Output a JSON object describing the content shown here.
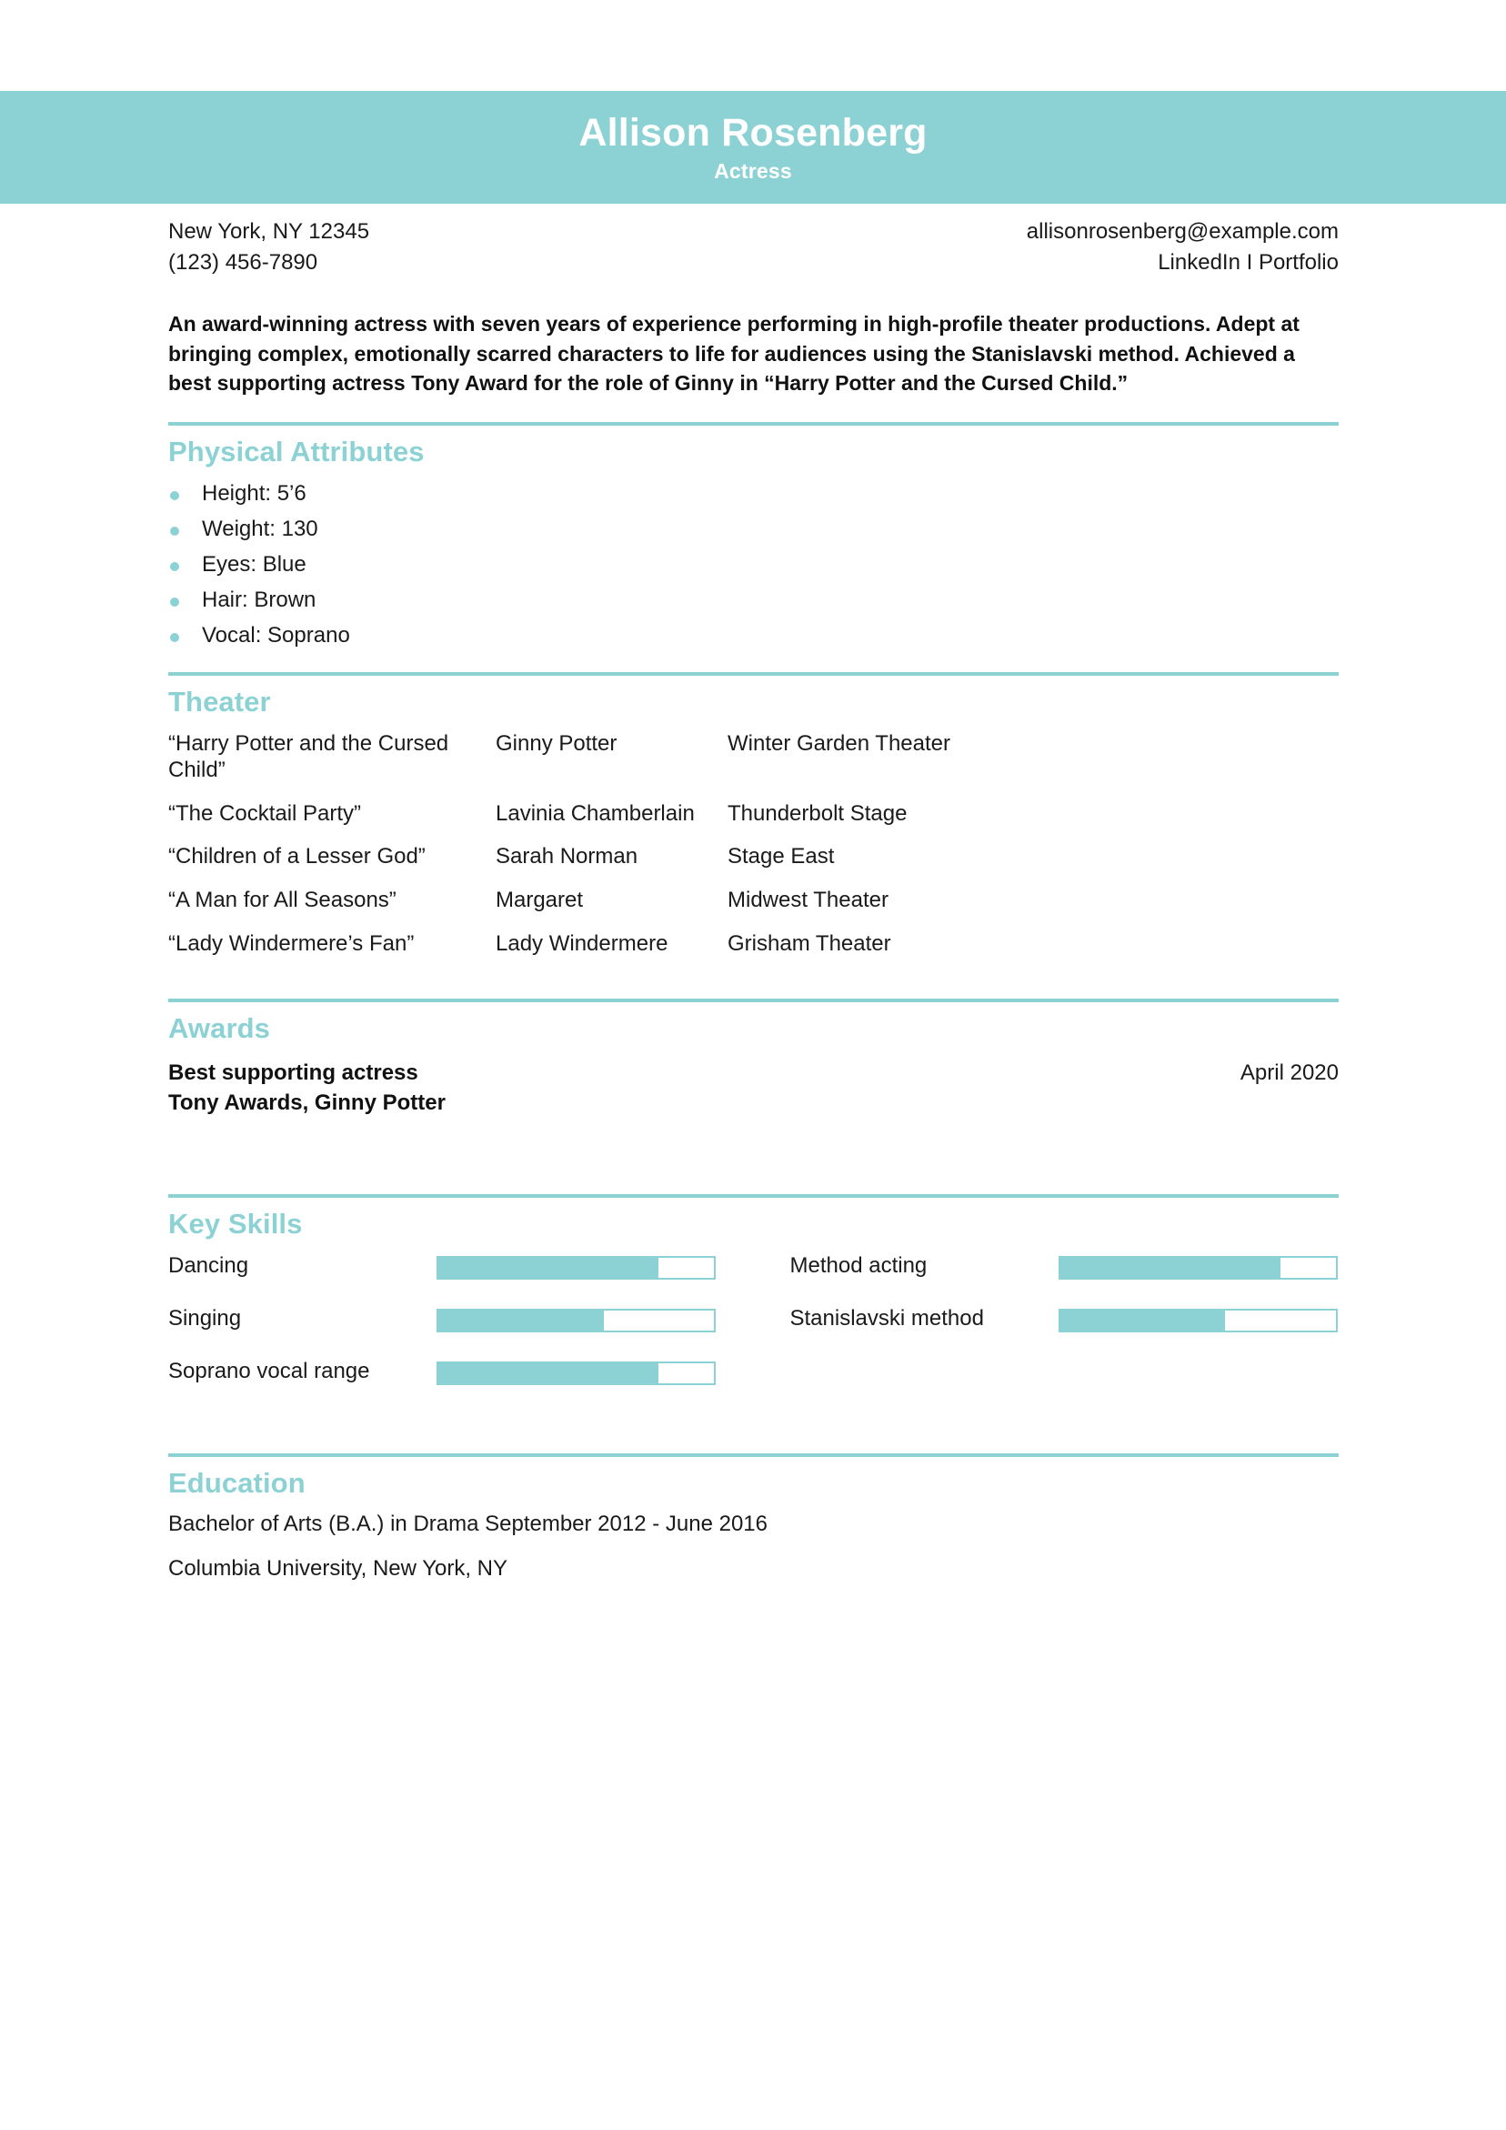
{
  "colors": {
    "accent": "#8CD2D4",
    "header_text": "#ffffff",
    "body_text": "#1a1a1a"
  },
  "header": {
    "name": "Allison Rosenberg",
    "role": "Actress"
  },
  "contact": {
    "location": "New York, NY 12345",
    "phone": "(123) 456-7890",
    "email": "allisonrosenberg@example.com",
    "links": "LinkedIn I Portfolio"
  },
  "summary": {
    "text": "An award-winning actress with seven years of experience performing in high-profile theater productions. Adept at bringing complex, emotionally scarred characters to life for audiences using the Stanislavski method. Achieved a best supporting actress Tony Award for the role of Ginny in “Harry Potter and the Cursed Child.”"
  },
  "physical_attributes": {
    "title": "Physical Attributes",
    "items": [
      "Height: 5’6",
      "Weight: 130",
      "Eyes: Blue",
      "Hair: Brown",
      "Vocal: Soprano"
    ]
  },
  "theater": {
    "title": "Theater",
    "rows": [
      {
        "show": "“Harry Potter and the Cursed Child”",
        "role": "Ginny Potter",
        "venue": "Winter Garden Theater"
      },
      {
        "show": "“The Cocktail Party”",
        "role": "Lavinia Chamberlain",
        "venue": "Thunderbolt Stage"
      },
      {
        "show": "“Children of a Lesser God”",
        "role": "Sarah Norman",
        "venue": "Stage East"
      },
      {
        "show": "“A Man for All Seasons”",
        "role": "Margaret",
        "venue": "Midwest Theater"
      },
      {
        "show": "“Lady Windermere’s Fan”",
        "role": "Lady Windermere",
        "venue": "Grisham Theater"
      }
    ]
  },
  "awards": {
    "title": "Awards",
    "entries": [
      {
        "line1": "Best supporting actress",
        "line2": "Tony Awards, Ginny Potter",
        "date": "April 2020"
      }
    ]
  },
  "key_skills": {
    "title": "Key Skills",
    "items": [
      {
        "label": "Dancing",
        "level": 80
      },
      {
        "label": "Method acting",
        "level": 80
      },
      {
        "label": "Singing",
        "level": 60
      },
      {
        "label": "Stanislavski method",
        "level": 60
      },
      {
        "label": "Soprano vocal range",
        "level": 80
      },
      {
        "label": "",
        "level": 0
      }
    ]
  },
  "education": {
    "title": "Education",
    "lines": [
      "Bachelor of Arts (B.A.) in Drama September 2012 - June 2016",
      "Columbia University, New York, NY"
    ]
  }
}
